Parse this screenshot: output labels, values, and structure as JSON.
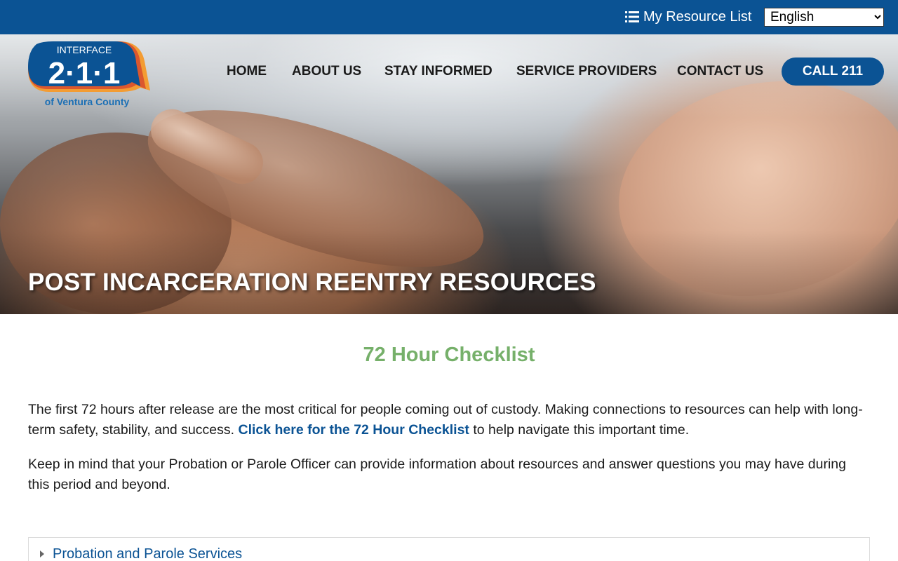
{
  "topbar": {
    "resource_list_label": "My Resource List",
    "language_selected": "English",
    "list_icon": "list-icon"
  },
  "logo": {
    "line1": "INTERFACE",
    "line2": "2·1·1",
    "line3": "of Ventura County"
  },
  "nav": {
    "items": [
      {
        "label": "HOME"
      },
      {
        "label": "ABOUT US"
      },
      {
        "label": "STAY INFORMED"
      },
      {
        "label": "SERVICE PROVIDERS"
      },
      {
        "label": "CONTACT US"
      }
    ],
    "call_label": "CALL 211"
  },
  "hero": {
    "title": "POST INCARCERATION REENTRY RESOURCES"
  },
  "main": {
    "section_title": "72 Hour Checklist",
    "para1_before": "The first 72 hours after release are the most critical for people coming out of custody. Making connections to resources can help with long-term safety, stability, and success. ",
    "para1_link": "Click here for the 72 Hour Checklist",
    "para1_after": " to help navigate this important time.",
    "para2": "Keep in mind that your Probation or Parole Officer can provide information about resources and answer questions you may have during this period and beyond.",
    "accordion": [
      {
        "label": "Probation and Parole Services"
      }
    ]
  },
  "colors": {
    "brand_blue": "#0b5394",
    "accent_green": "#76b06a",
    "logo_orange": "#f39c33",
    "logo_red": "#d64b2e"
  }
}
